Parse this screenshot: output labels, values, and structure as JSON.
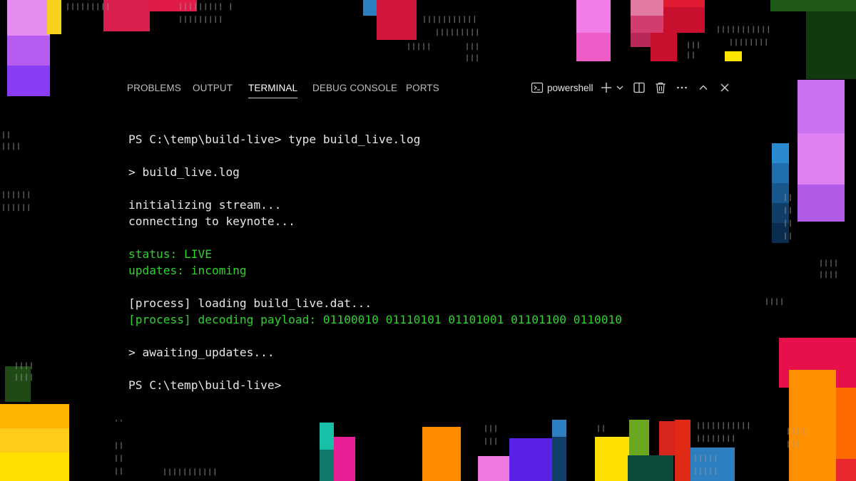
{
  "panel": {
    "tabs": [
      "PROBLEMS",
      "OUTPUT",
      "TERMINAL",
      "DEBUG CONSOLE",
      "PORTS"
    ],
    "active_tab": "TERMINAL",
    "shell_label": "powershell",
    "toolbar_icons": [
      "terminal-icon",
      "add-icon",
      "chevron-down-icon",
      "split-icon",
      "trash-icon",
      "more-icon",
      "maximize-icon",
      "close-icon"
    ]
  },
  "terminal": {
    "lines": [
      {
        "text": "PS C:\\temp\\build-live> type build_live.log",
        "color": "default"
      },
      {
        "text": "",
        "color": "default"
      },
      {
        "text": "> build_live.log",
        "color": "default"
      },
      {
        "text": "",
        "color": "default"
      },
      {
        "text": "initializing stream...",
        "color": "default"
      },
      {
        "text": "connecting to keynote...",
        "color": "default"
      },
      {
        "text": "",
        "color": "default"
      },
      {
        "text": "status: LIVE",
        "color": "green"
      },
      {
        "text": "updates: incoming",
        "color": "green"
      },
      {
        "text": "",
        "color": "default"
      },
      {
        "text": "[process] loading build_live.dat...",
        "color": "default"
      },
      {
        "text": "[process] decoding payload: 01100010 01110101 01101001 01101100 0110010",
        "color": "green"
      },
      {
        "text": "",
        "color": "default"
      },
      {
        "text": "> awaiting_updates...",
        "color": "default"
      },
      {
        "text": "",
        "color": "default"
      },
      {
        "text": "PS C:\\temp\\build-live>",
        "color": "default"
      }
    ]
  },
  "colors": {
    "background": "#000000",
    "text": "#e6e6e6",
    "green": "#2ed32e",
    "tab_inactive": "#bdbdbd",
    "tab_active": "#ffffff"
  }
}
